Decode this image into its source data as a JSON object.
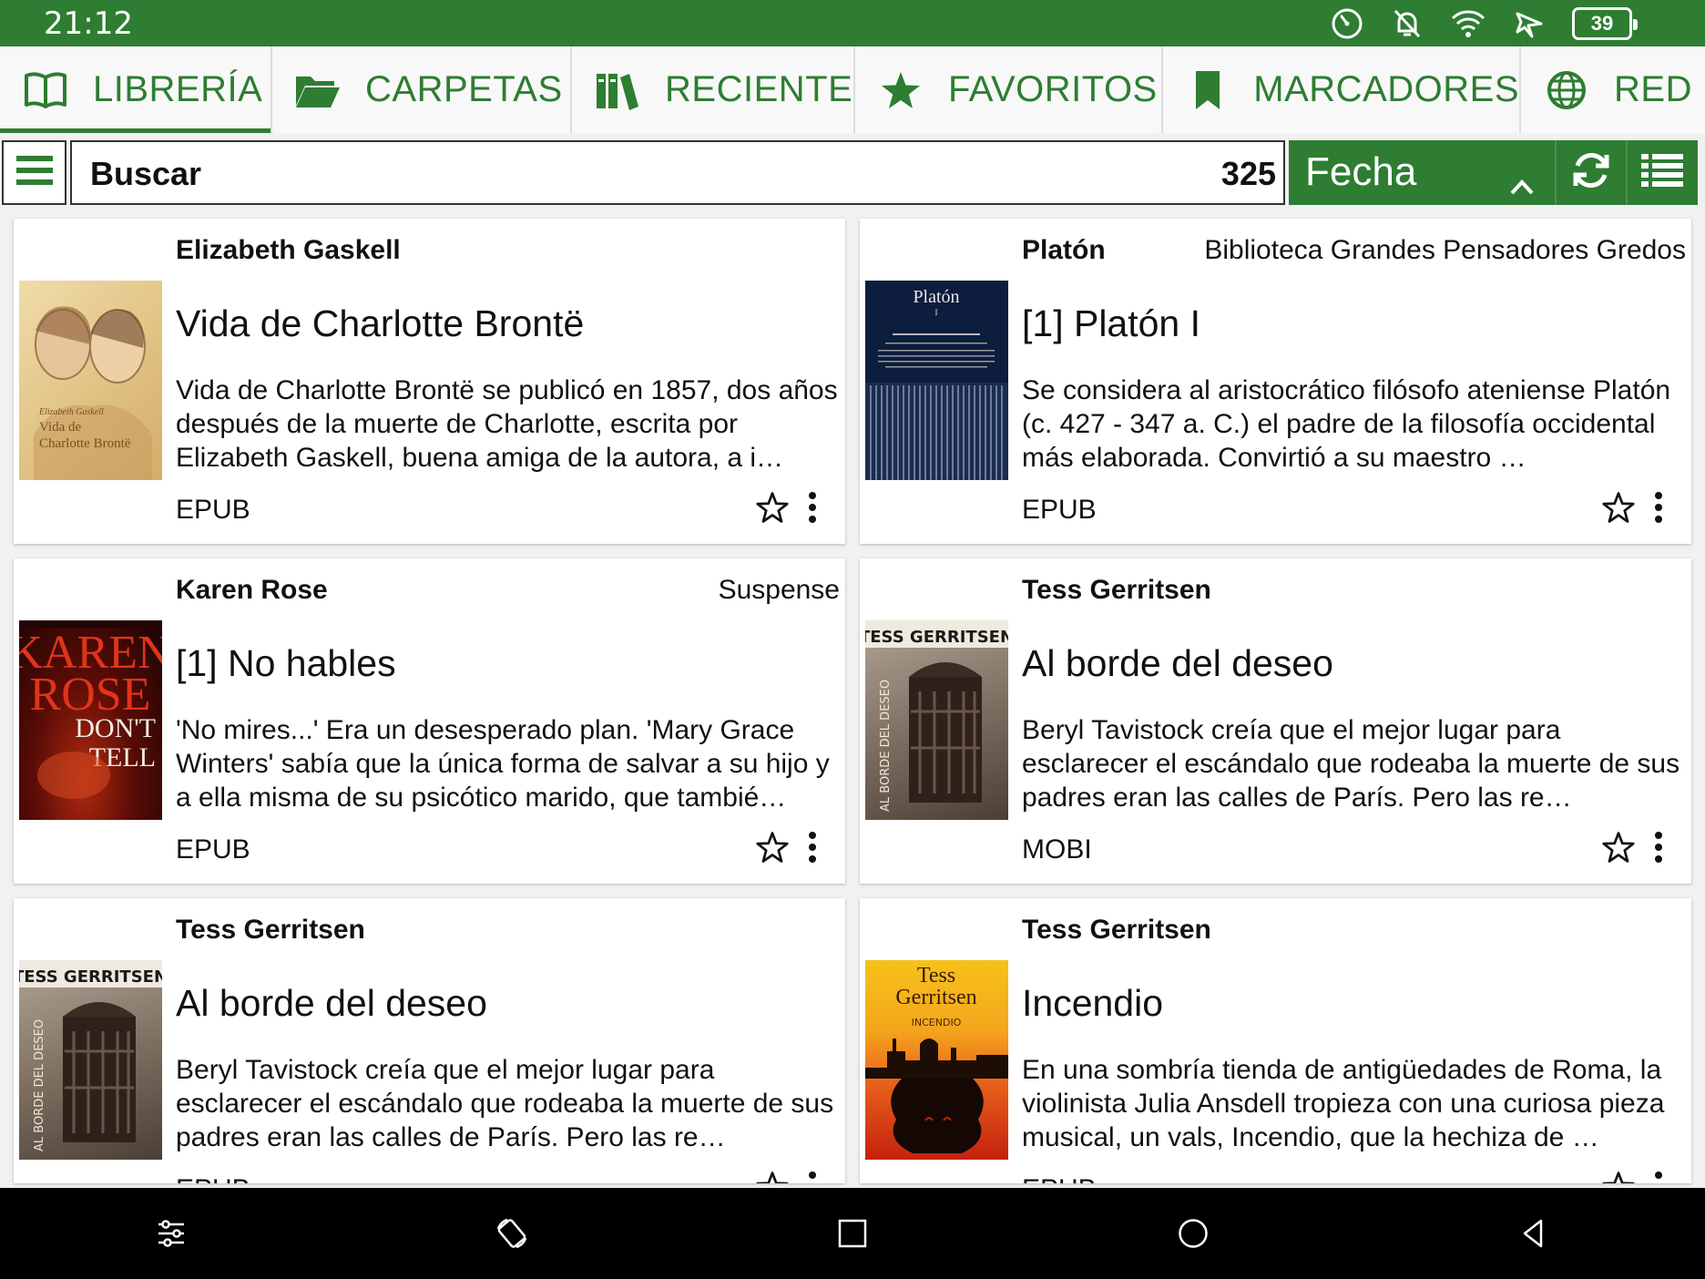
{
  "status_bar": {
    "time": "21:12",
    "battery": "39"
  },
  "tabs": [
    {
      "label": "LIBRERÍA",
      "icon": "book-open-icon",
      "active": true
    },
    {
      "label": "CARPETAS",
      "icon": "folder-icon",
      "active": false
    },
    {
      "label": "RECIENTE",
      "icon": "books-shelf-icon",
      "active": false
    },
    {
      "label": "FAVORITOS",
      "icon": "star-icon",
      "active": false
    },
    {
      "label": "MARCADORES",
      "icon": "bookmark-icon",
      "active": false
    },
    {
      "label": "RED",
      "icon": "globe-icon",
      "active": false
    }
  ],
  "toolbar": {
    "search_placeholder": "Buscar",
    "count": "325",
    "sort_label": "Fecha"
  },
  "books": [
    {
      "author": "Elizabeth Gaskell",
      "series": "",
      "title": "Vida de Charlotte Brontë",
      "description": "Vida de Charlotte Brontë se publicó en 1857, dos años después de la muerte de Charlotte, escrita por Elizabeth Gaskell, buena amiga de la autora, a i…",
      "format": "EPUB",
      "cover_text": [
        "Elizabeth Gaskell",
        "Vida de Charlotte Brontë"
      ]
    },
    {
      "author": "Platón",
      "series": "Biblioteca Grandes Pensadores Gredos",
      "title": "[1] Platón I",
      "description": "Se considera al aristocrático filósofo ateniense Platón (c. 427 - 347 a. C.) el padre de la filosofía occidental más elaborada. Convirtió a su maestro …",
      "format": "EPUB",
      "cover_text": [
        "Platón",
        "I"
      ]
    },
    {
      "author": "Karen Rose",
      "series": "Suspense",
      "title": "[1] No hables",
      "description": "'No mires...' Era un desesperado plan. 'Mary Grace Winters' sabía que la única forma de salvar a su hijo y a ella misma de su psicótico marido, que tambié…",
      "format": "EPUB",
      "cover_text": [
        "KAREN",
        "ROSE",
        "DON'T",
        "TELL"
      ]
    },
    {
      "author": "Tess Gerritsen",
      "series": "",
      "title": "Al borde del deseo",
      "description": "Beryl Tavistock creía que el mejor lugar para esclarecer el escándalo que rodeaba la muerte de sus padres eran las calles de París. Pero las re…",
      "format": "MOBI",
      "cover_text": [
        "TESS GERRITSEN",
        "AL BORDE DEL DESEO"
      ]
    },
    {
      "author": "Tess Gerritsen",
      "series": "",
      "title": "Al borde del deseo",
      "description": "Beryl Tavistock creía que el mejor lugar para esclarecer el escándalo que rodeaba la muerte de sus padres eran las calles de París. Pero las re…",
      "format": "EPUB",
      "cover_text": [
        "TESS GERRITSEN",
        "AL BORDE DEL DESEO"
      ]
    },
    {
      "author": "Tess Gerritsen",
      "series": "",
      "title": "Incendio",
      "description": "En una sombría tienda de antigüedades de Roma, la violinista Julia Ansdell tropieza con una curiosa pieza musical, un vals, Incendio, que la hechiza de …",
      "format": "EPUB",
      "cover_text": [
        "Tess",
        "Gerritsen",
        "INCENDIO"
      ]
    }
  ],
  "colors": {
    "accent": "#2e7d32",
    "nav_bg": "#000000",
    "card_bg": "#ffffff"
  }
}
